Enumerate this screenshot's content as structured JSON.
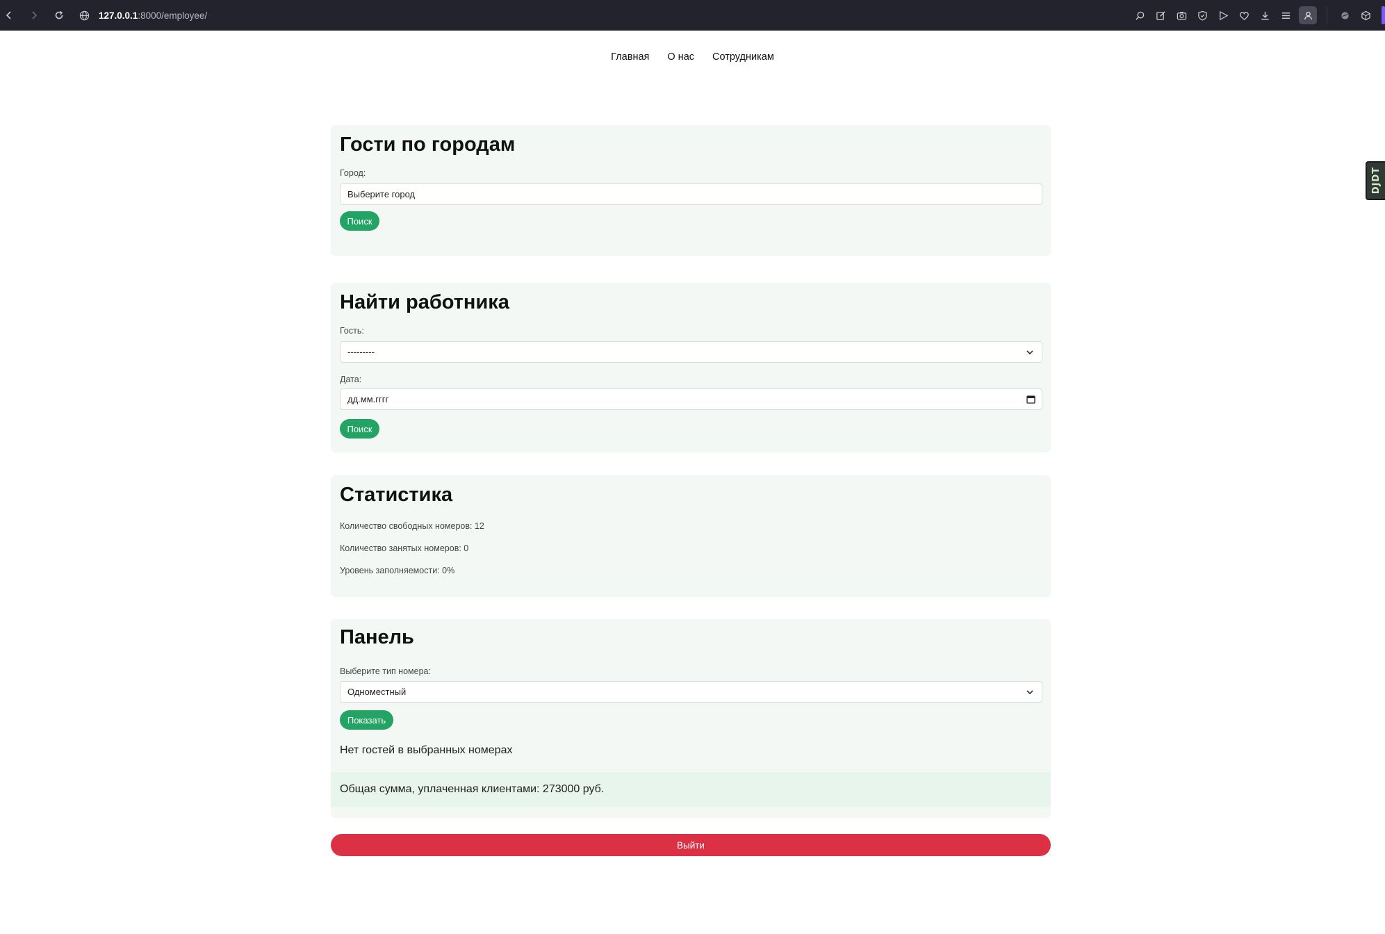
{
  "browser": {
    "url_host": "127.0.0.1",
    "url_rest": ":8000/employee/"
  },
  "nav": {
    "items": [
      "Главная",
      "О нас",
      "Сотрудникам"
    ]
  },
  "city_section": {
    "title": "Гости по городам",
    "label": "Город:",
    "placeholder": "Выберите город",
    "button": "Поиск"
  },
  "worker_section": {
    "title": "Найти работника",
    "guest_label": "Гость:",
    "guest_value": "---------",
    "date_label": "Дата:",
    "date_placeholder": "дд.мм.гггг",
    "button": "Поиск"
  },
  "stats_section": {
    "title": "Статистика",
    "free_rooms": "Количество свободных номеров: 12",
    "occupied_rooms": "Количество занятых номеров: 0",
    "occupancy": "Уровень заполняемости: 0%"
  },
  "panel_section": {
    "title": "Панель",
    "room_type_label": "Выберите тип номера:",
    "room_type_value": "Одноместный",
    "button": "Показать",
    "empty_message": "Нет гостей в выбранных номерах",
    "total_paid": "Общая сумма, уплаченная клиентами: 273000 руб."
  },
  "logout": {
    "label": "Выйти"
  },
  "side_widget": {
    "label": "DJDT"
  },
  "colors": {
    "accent_green": "#24a464",
    "logout_red": "#dc3145",
    "card_bg": "#f3f8f5",
    "chrome_bg": "#23232e"
  }
}
